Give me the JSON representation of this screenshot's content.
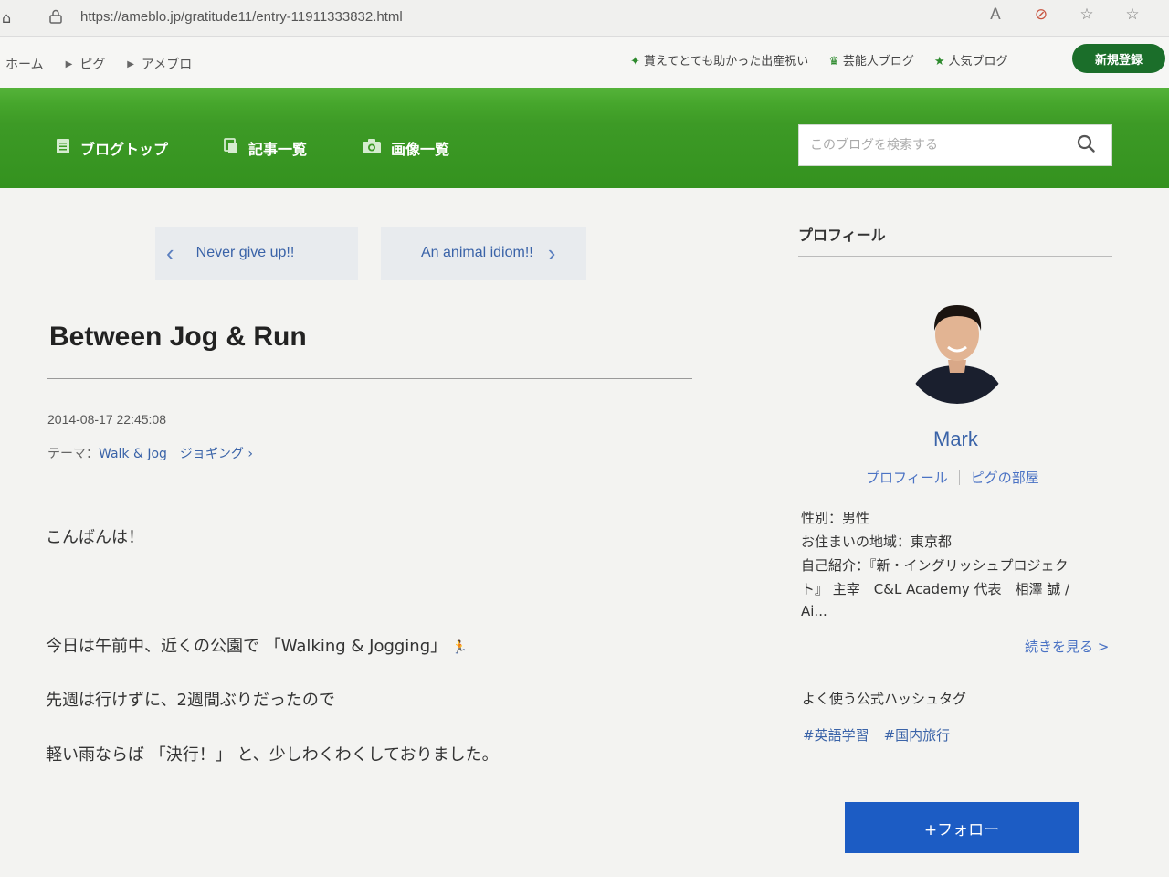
{
  "browser": {
    "url": "https://ameblo.jp/gratitude11/entry-11911333832.html"
  },
  "breadcrumb": {
    "items": [
      "ホーム",
      "ピグ",
      "アメブロ"
    ]
  },
  "top_links": [
    {
      "icon": "sparkle-icon",
      "label": "貰えてとても助かった出産祝い"
    },
    {
      "icon": "crown-icon",
      "label": "芸能人ブログ"
    },
    {
      "icon": "star-icon",
      "label": "人気ブログ"
    }
  ],
  "signup_label": "新規登録",
  "nav": {
    "items": [
      {
        "icon": "document-icon",
        "label": "ブログトップ"
      },
      {
        "icon": "copy-icon",
        "label": "記事一覧"
      },
      {
        "icon": "camera-icon",
        "label": "画像一覧"
      }
    ],
    "search_placeholder": "このブログを検索する"
  },
  "pager": {
    "prev_label": "Never give up!!",
    "next_label": "An animal idiom!!"
  },
  "entry": {
    "title": "Between Jog & Run",
    "date": "2014-08-17 22:45:08",
    "theme_prefix": "テーマ：",
    "theme_link": "Walk & Jog",
    "theme_tag": "ジョギング",
    "lines": [
      "こんばんは！",
      "今日は午前中、近くの公園で 「Walking & Jogging」",
      "先週は行けずに、2週間ぶりだったので",
      "軽い雨ならば 「決行！」 と、少しわくわくしておりました。"
    ]
  },
  "sidebar": {
    "heading": "プロフィール",
    "name": "Mark",
    "link_profile": "プロフィール",
    "link_room": "ピグの部屋",
    "info": [
      "性別：男性",
      "お住まいの地域：東京都",
      "自己紹介：『新・イングリッシュプロジェク",
      "ト』 主宰　C&L Academy 代表　相澤 誠 /",
      "Ai..."
    ],
    "more_label": "続きを見る >",
    "hashtag_heading": "よく使う公式ハッシュタグ",
    "hashtags": [
      "#英語学習",
      "#国内旅行"
    ],
    "follow_label": "+フォロー"
  }
}
